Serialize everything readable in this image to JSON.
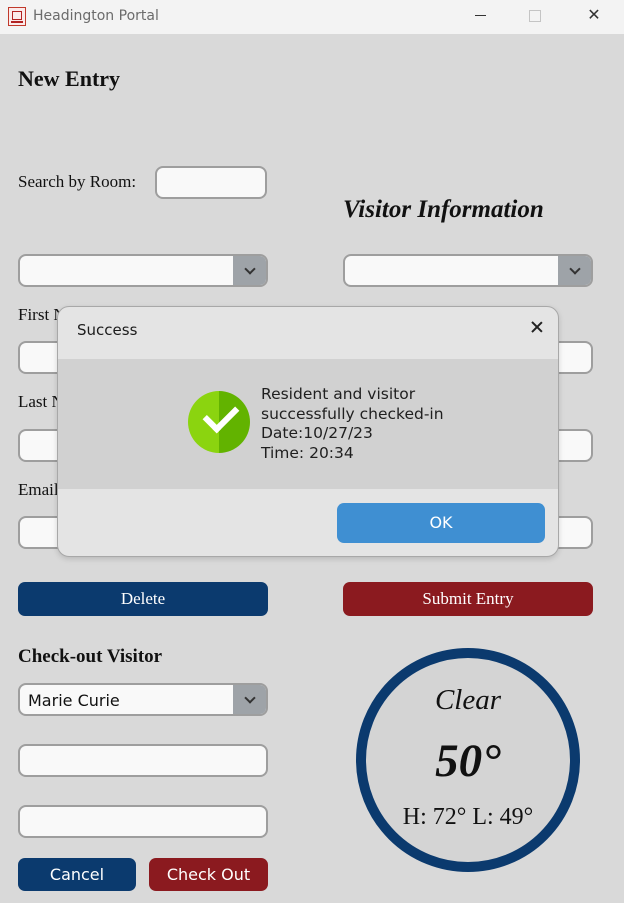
{
  "titlebar": {
    "title": "Headington Portal"
  },
  "form": {
    "heading": "New Entry",
    "search_label": "Search by Room:",
    "visitor_heading": "Visitor Information",
    "first_name_label": "First N",
    "last_name_label": "Last N",
    "email_label": "Email",
    "delete_label": "Delete",
    "submit_label": "Submit Entry"
  },
  "checkout": {
    "heading": "Check-out Visitor",
    "selected_visitor": "Marie Curie",
    "cancel_label": "Cancel",
    "checkout_label": "Check Out"
  },
  "weather": {
    "condition": "Clear",
    "temperature": "50°",
    "high_low": "H: 72°  L: 49°"
  },
  "dialog": {
    "title": "Success",
    "lines": [
      "Resident and visitor",
      "successfully checked-in",
      "Date:10/27/23",
      "Time: 20:34"
    ],
    "ok_label": "OK"
  },
  "icons": {
    "app": "building-logo-icon",
    "success": "checkmark-circle-icon"
  },
  "colors": {
    "primary_blue": "#0b3a6e",
    "primary_red": "#8b1a1f",
    "ok_blue": "#3f8fd2",
    "success_green": "#8bd40f"
  }
}
